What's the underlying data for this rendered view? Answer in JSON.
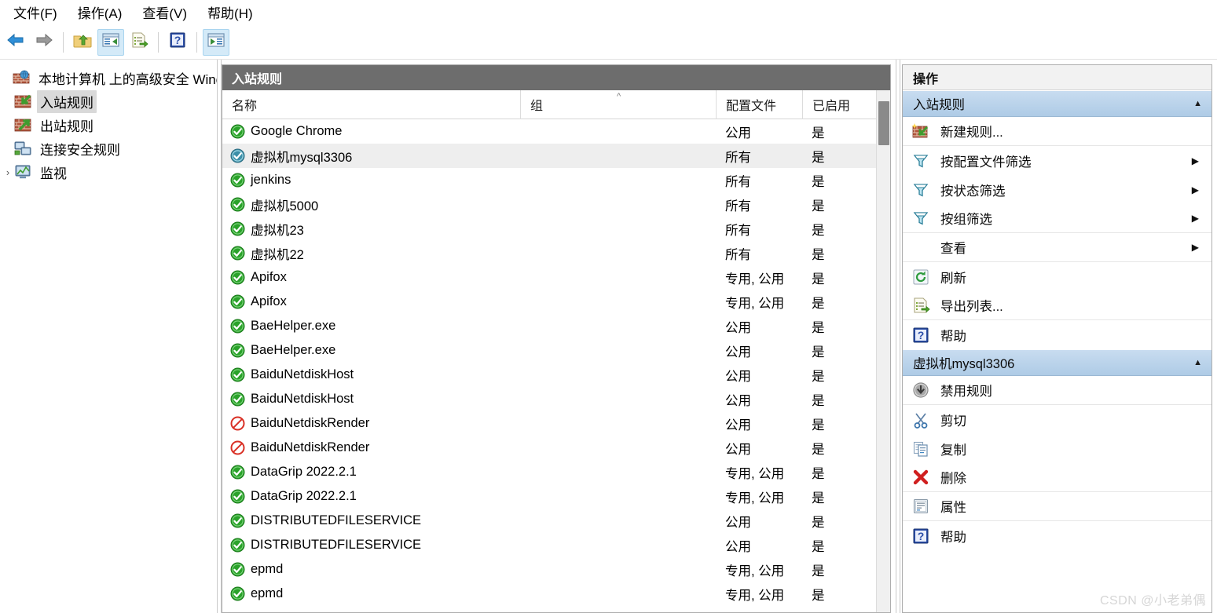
{
  "menubar": {
    "items": [
      {
        "label": "文件(F)",
        "name": "menu-file"
      },
      {
        "label": "操作(A)",
        "name": "menu-action"
      },
      {
        "label": "查看(V)",
        "name": "menu-view"
      },
      {
        "label": "帮助(H)",
        "name": "menu-help"
      }
    ]
  },
  "toolbar": {
    "buttons": [
      {
        "name": "back-button",
        "icon": "back-arrow-icon",
        "framed": false
      },
      {
        "name": "forward-button",
        "icon": "forward-arrow-icon",
        "framed": false
      },
      {
        "name": "up-folder-button",
        "icon": "up-folder-icon",
        "framed": false
      },
      {
        "name": "show-hide-tree-button",
        "icon": "show-hide-console-tree-icon",
        "framed": true
      },
      {
        "name": "export-list-button",
        "icon": "export-list-icon",
        "framed": false
      },
      {
        "name": "help-button",
        "icon": "help-question-icon",
        "framed": false
      },
      {
        "name": "show-hide-action-pane-button",
        "icon": "show-hide-action-pane-icon",
        "framed": true
      }
    ]
  },
  "tree": {
    "root": {
      "label": "本地计算机 上的高级安全 Wind",
      "icon": "firewall-computer-icon"
    },
    "items": [
      {
        "label": "入站规则",
        "icon": "inbound-rules-icon",
        "selected": true,
        "expandable": false
      },
      {
        "label": "出站规则",
        "icon": "outbound-rules-icon",
        "selected": false,
        "expandable": false
      },
      {
        "label": "连接安全规则",
        "icon": "connection-security-rules-icon",
        "selected": false,
        "expandable": false
      },
      {
        "label": "监视",
        "icon": "monitoring-icon",
        "selected": false,
        "expandable": true
      }
    ]
  },
  "list": {
    "title": "入站规则",
    "columns": [
      {
        "label": "名称",
        "name": "column-name",
        "sorted": false
      },
      {
        "label": "组",
        "name": "column-group",
        "sorted": true,
        "sort_glyph": "^"
      },
      {
        "label": "配置文件",
        "name": "column-profile",
        "sorted": false
      },
      {
        "label": "已启用",
        "name": "column-enabled",
        "sorted": false
      }
    ],
    "rows": [
      {
        "name": "Google Chrome",
        "status": "allow",
        "group": "",
        "profile": "公用",
        "enabled": "是",
        "selected": false
      },
      {
        "name": "虚拟机mysql3306",
        "status": "allow",
        "group": "",
        "profile": "所有",
        "enabled": "是",
        "selected": true
      },
      {
        "name": "jenkins",
        "status": "allow",
        "group": "",
        "profile": "所有",
        "enabled": "是",
        "selected": false
      },
      {
        "name": "虚拟机5000",
        "status": "allow",
        "group": "",
        "profile": "所有",
        "enabled": "是",
        "selected": false
      },
      {
        "name": "虚拟机23",
        "status": "allow",
        "group": "",
        "profile": "所有",
        "enabled": "是",
        "selected": false
      },
      {
        "name": "虚拟机22",
        "status": "allow",
        "group": "",
        "profile": "所有",
        "enabled": "是",
        "selected": false
      },
      {
        "name": "Apifox",
        "status": "allow",
        "group": "",
        "profile": "专用, 公用",
        "enabled": "是",
        "selected": false
      },
      {
        "name": "Apifox",
        "status": "allow",
        "group": "",
        "profile": "专用, 公用",
        "enabled": "是",
        "selected": false
      },
      {
        "name": "BaeHelper.exe",
        "status": "allow",
        "group": "",
        "profile": "公用",
        "enabled": "是",
        "selected": false
      },
      {
        "name": "BaeHelper.exe",
        "status": "allow",
        "group": "",
        "profile": "公用",
        "enabled": "是",
        "selected": false
      },
      {
        "name": "BaiduNetdiskHost",
        "status": "allow",
        "group": "",
        "profile": "公用",
        "enabled": "是",
        "selected": false
      },
      {
        "name": "BaiduNetdiskHost",
        "status": "allow",
        "group": "",
        "profile": "公用",
        "enabled": "是",
        "selected": false
      },
      {
        "name": "BaiduNetdiskRender",
        "status": "block",
        "group": "",
        "profile": "公用",
        "enabled": "是",
        "selected": false
      },
      {
        "name": "BaiduNetdiskRender",
        "status": "block",
        "group": "",
        "profile": "公用",
        "enabled": "是",
        "selected": false
      },
      {
        "name": "DataGrip 2022.2.1",
        "status": "allow",
        "group": "",
        "profile": "专用, 公用",
        "enabled": "是",
        "selected": false
      },
      {
        "name": "DataGrip 2022.2.1",
        "status": "allow",
        "group": "",
        "profile": "专用, 公用",
        "enabled": "是",
        "selected": false
      },
      {
        "name": "DISTRIBUTEDFILESERVICE",
        "status": "allow",
        "group": "",
        "profile": "公用",
        "enabled": "是",
        "selected": false
      },
      {
        "name": "DISTRIBUTEDFILESERVICE",
        "status": "allow",
        "group": "",
        "profile": "公用",
        "enabled": "是",
        "selected": false
      },
      {
        "name": "epmd",
        "status": "allow",
        "group": "",
        "profile": "专用, 公用",
        "enabled": "是",
        "selected": false
      },
      {
        "name": "epmd",
        "status": "allow",
        "group": "",
        "profile": "专用, 公用",
        "enabled": "是",
        "selected": false
      }
    ]
  },
  "actions": {
    "title": "操作",
    "groups": [
      {
        "header": "入站规则",
        "name": "action-group-inbound-rules",
        "collapse_glyph": "▲",
        "items": [
          {
            "label": "新建规则...",
            "icon": "new-rule-icon",
            "name": "action-new-rule",
            "submenu": false,
            "divider": true
          },
          {
            "label": "按配置文件筛选",
            "icon": "filter-icon",
            "name": "action-filter-by-profile",
            "submenu": true,
            "divider": false
          },
          {
            "label": "按状态筛选",
            "icon": "filter-icon",
            "name": "action-filter-by-state",
            "submenu": true,
            "divider": false
          },
          {
            "label": "按组筛选",
            "icon": "filter-icon",
            "name": "action-filter-by-group",
            "submenu": true,
            "divider": true
          },
          {
            "label": "查看",
            "icon": "none",
            "name": "action-view",
            "submenu": true,
            "divider": true
          },
          {
            "label": "刷新",
            "icon": "refresh-icon",
            "name": "action-refresh",
            "submenu": false,
            "divider": false
          },
          {
            "label": "导出列表...",
            "icon": "export-list-icon",
            "name": "action-export-list",
            "submenu": false,
            "divider": true
          },
          {
            "label": "帮助",
            "icon": "help-question-icon",
            "name": "action-help",
            "submenu": false,
            "divider": false
          }
        ]
      },
      {
        "header": "虚拟机mysql3306",
        "name": "action-group-selected-rule",
        "collapse_glyph": "▲",
        "items": [
          {
            "label": "禁用规则",
            "icon": "disable-rule-icon",
            "name": "action-disable-rule",
            "submenu": false,
            "divider": true
          },
          {
            "label": "剪切",
            "icon": "cut-scissors-icon",
            "name": "action-cut",
            "submenu": false,
            "divider": false
          },
          {
            "label": "复制",
            "icon": "copy-icon",
            "name": "action-copy",
            "submenu": false,
            "divider": false
          },
          {
            "label": "删除",
            "icon": "delete-x-icon",
            "name": "action-delete",
            "submenu": false,
            "divider": true
          },
          {
            "label": "属性",
            "icon": "properties-icon",
            "name": "action-properties",
            "submenu": false,
            "divider": true
          },
          {
            "label": "帮助",
            "icon": "help-question-icon",
            "name": "action-help",
            "submenu": false,
            "divider": false
          }
        ]
      }
    ]
  },
  "watermark": {
    "text": "CSDN @小老弟偶"
  },
  "colors": {
    "list_title_bg": "#6d6d6d",
    "group_header_bg": "#aecbe6",
    "allow_green": "#2aa22a",
    "block_red": "#d93025",
    "selection_gray": "#eeeeee"
  }
}
